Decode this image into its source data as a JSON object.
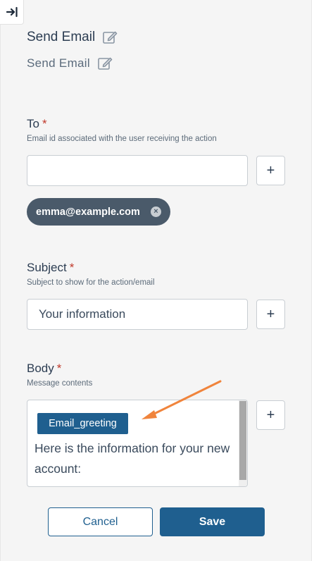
{
  "header": {
    "title": "Send Email",
    "subtitle": "Send Email"
  },
  "fields": {
    "to": {
      "label": "To",
      "required_mark": "*",
      "help": "Email id associated with the user receiving the action",
      "value": "",
      "add_label": "+",
      "chips": [
        "emma@example.com"
      ],
      "chip_remove_glyph": "×"
    },
    "subject": {
      "label": "Subject",
      "required_mark": "*",
      "help": "Subject to show for the action/email",
      "value": "Your information",
      "add_label": "+"
    },
    "body": {
      "label": "Body",
      "required_mark": "*",
      "help": "Message contents",
      "token": "Email_greeting",
      "text": "Here is the information for your new account:",
      "add_label": "+"
    }
  },
  "actions": {
    "cancel_label": "Cancel",
    "save_label": "Save"
  },
  "colors": {
    "primary": "#1f5f8f",
    "chip_bg": "#4a5a6a",
    "required": "#c0392b",
    "annotation_arrow": "#f0843c"
  },
  "icons": {
    "collapse": "collapse-panel-icon",
    "edit": "edit-icon",
    "remove": "close-icon"
  }
}
